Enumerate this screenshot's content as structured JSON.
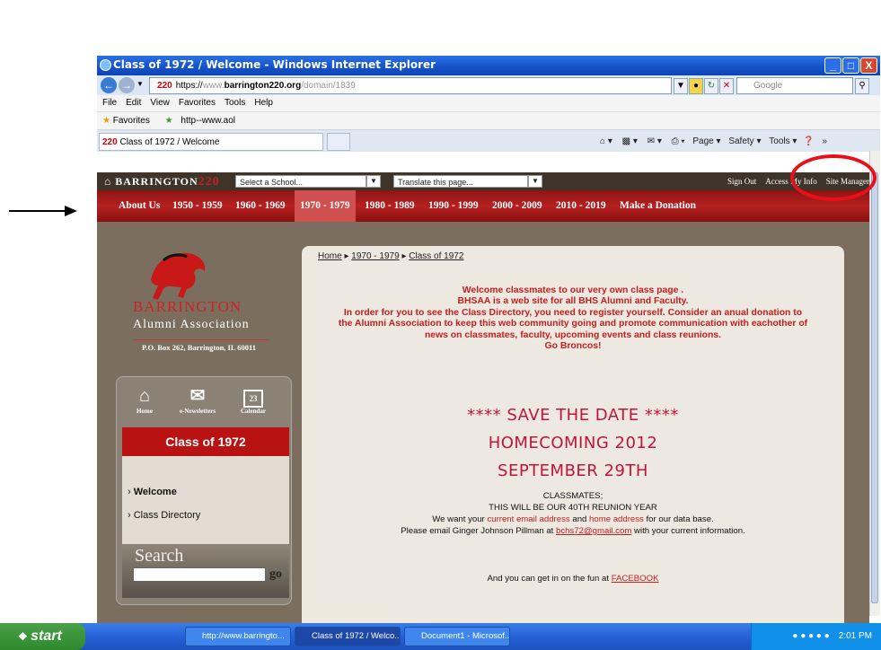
{
  "window": {
    "title": "Class of 1972 / Welcome - Windows Internet Explorer",
    "controls": {
      "minimize": "_",
      "maximize": "□",
      "close": "X"
    }
  },
  "addressbar": {
    "logo": "220",
    "url_scheme": "https://",
    "url_prefix": "www.",
    "url_domain": "barrington220.org",
    "url_path": "/domain/1839",
    "search_placeholder": "Google"
  },
  "menubar": [
    "File",
    "Edit",
    "View",
    "Favorites",
    "Tools",
    "Help"
  ],
  "favorites": {
    "label": "Favorites",
    "link": "http--www.aol"
  },
  "tab": {
    "logo": "220",
    "title": "Class of 1972 / Welcome"
  },
  "commandbar": {
    "page": "Page ▾",
    "safety": "Safety ▾",
    "tools": "Tools ▾",
    "more": "»"
  },
  "schoolbar": {
    "brand": "BARRINGTON",
    "brand_num": "220",
    "select_school": "Select a School...",
    "translate": "Translate this page...",
    "links": [
      "Sign Out",
      "Access My Info",
      "Site Manager"
    ]
  },
  "nav": [
    "About Us",
    "1950 - 1959",
    "1960 - 1969",
    "1970 - 1979",
    "1980 - 1989",
    "1990 - 1999",
    "2000 - 2009",
    "2010 - 2019",
    "Make a Donation"
  ],
  "sidebar": {
    "brand": "BARRINGTON",
    "assoc": "Alumni Association",
    "address": "P.O. Box 262, Barrington, IL 60011",
    "icons": [
      {
        "label": "Home",
        "icon": "home-icon"
      },
      {
        "label": "e-Newsletters",
        "icon": "newsletter-icon"
      },
      {
        "label": "Calendar",
        "icon": "calendar-icon"
      }
    ],
    "calendar_day": "23",
    "class_header": "Class of 1972",
    "menu": [
      "Welcome",
      "Class Directory"
    ],
    "search_label": "Search",
    "search_go": "go"
  },
  "content": {
    "breadcrumb": [
      "Home",
      "1970 - 1979",
      "Class of 1972"
    ],
    "welcome_lines": [
      "Welcome classmates to our very own class page .",
      "BHSAA is a web site for all BHS Alumni and Faculty.",
      "In order for you to see the Class Directory, you need to register yourself. Consider an anual donation to",
      "the Alumni Association to keep this web community going and promote communication with eachother of",
      "news on classmates, faculty, upcoming events and class reunions.",
      "Go Broncos!"
    ],
    "save_the_date": "**** SAVE THE DATE ****",
    "homecoming": "HOMECOMING 2012",
    "date": "SEPTEMBER 29TH",
    "classmates": "CLASSMATES;",
    "reunion": "THIS WILL BE OUR 40TH REUNION YEAR",
    "want_pre": "We want your ",
    "want_email": "current email address",
    "want_and": " and ",
    "want_home": "home address",
    "want_post": " for our data base.",
    "email_pre": "Please email Ginger Johnson Pillman at ",
    "email_addr": "bchs72@gmail.com",
    "email_post": " with your current information.",
    "fun_pre": "And you can get in on the fun at ",
    "fun_link": "FACEBOOK"
  },
  "taskbar": {
    "start": "start",
    "items": [
      "http://www.barringto...",
      "Class of 1972 / Welco...",
      "Document1 - Microsof..."
    ],
    "clock": "2:01 PM"
  },
  "colors": {
    "annotation": "#e8101a",
    "nav_red": "#b62020",
    "brown_bg": "#7c6e5e",
    "class_header": "#b81212"
  }
}
